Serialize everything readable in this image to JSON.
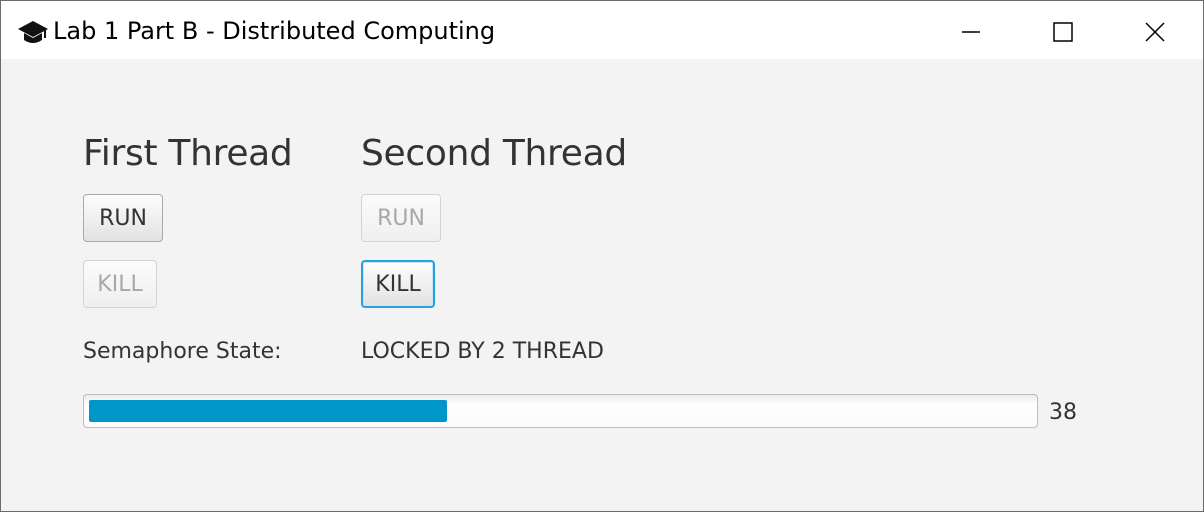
{
  "window": {
    "title": "Lab 1 Part B - Distributed Computing",
    "app_icon": "graduation-cap-icon",
    "controls": [
      "minimize-icon",
      "maximize-icon",
      "close-icon"
    ]
  },
  "threads": {
    "first": {
      "heading": "First Thread",
      "run_label": "RUN",
      "kill_label": "KILL"
    },
    "second": {
      "heading": "Second Thread",
      "run_label": "RUN",
      "kill_label": "KILL"
    }
  },
  "semaphore": {
    "label": "Semaphore State:",
    "value": "LOCKED BY 2 THREAD"
  },
  "progress": {
    "value": 38,
    "display": "38",
    "fraction": 0.38,
    "color": "#0096c9"
  }
}
